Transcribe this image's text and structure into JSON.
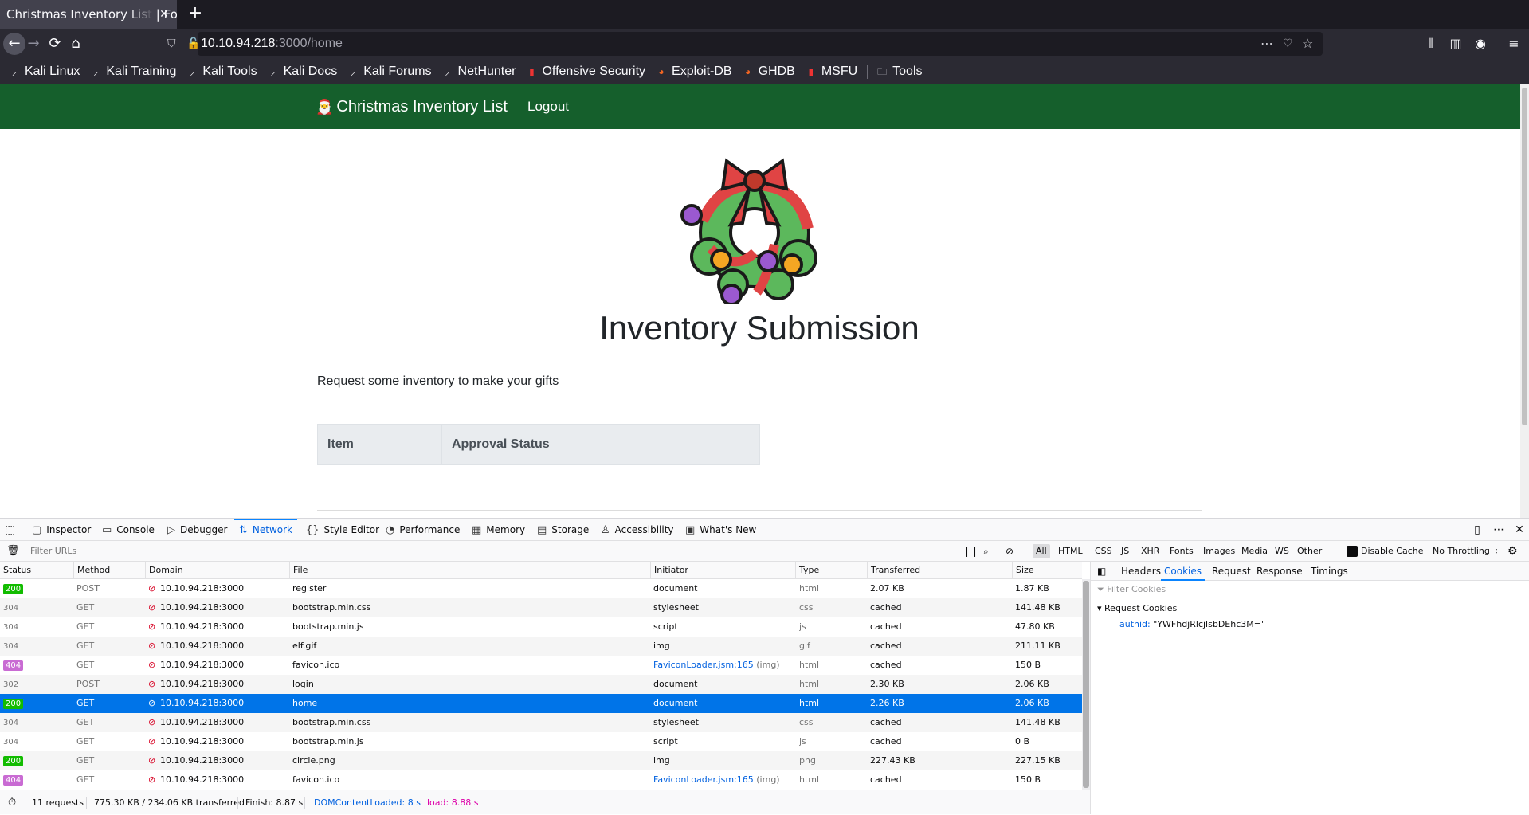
{
  "browser": {
    "tab_title": "Christmas Inventory List | Fo",
    "url_host": "10.10.94.218",
    "url_path": ":3000/home",
    "bookmarks": [
      "Kali Linux",
      "Kali Training",
      "Kali Tools",
      "Kali Docs",
      "Kali Forums",
      "NetHunter",
      "Offensive Security",
      "Exploit-DB",
      "GHDB",
      "MSFU",
      "Tools"
    ]
  },
  "site": {
    "brand": "Christmas Inventory List",
    "logout": "Logout",
    "heading": "Inventory Submission",
    "intro": "Request some inventory to make your gifts",
    "table_headers": [
      "Item",
      "Approval Status"
    ],
    "nav_color": "#155f2c"
  },
  "devtools": {
    "tabs": [
      "Inspector",
      "Console",
      "Debugger",
      "Network",
      "Style Editor",
      "Performance",
      "Memory",
      "Storage",
      "Accessibility",
      "What's New"
    ],
    "active_tab": "Network",
    "filter_placeholder": "Filter URLs",
    "type_filters": [
      "All",
      "HTML",
      "CSS",
      "JS",
      "XHR",
      "Fonts",
      "Images",
      "Media",
      "WS",
      "Other"
    ],
    "disable_cache": "Disable Cache",
    "throttling": "No Throttling ÷",
    "columns": [
      "Status",
      "Method",
      "Domain",
      "File",
      "Initiator",
      "Type",
      "Transferred",
      "Size"
    ],
    "requests": [
      {
        "status": "200",
        "method": "POST",
        "domain": "10.10.94.218:3000",
        "file": "register",
        "initiator": "document",
        "initiator_sub": "",
        "type": "html",
        "transferred": "2.07 KB",
        "size": "1.87 KB"
      },
      {
        "status": "304",
        "method": "GET",
        "domain": "10.10.94.218:3000",
        "file": "bootstrap.min.css",
        "initiator": "stylesheet",
        "initiator_sub": "",
        "type": "css",
        "transferred": "cached",
        "size": "141.48 KB"
      },
      {
        "status": "304",
        "method": "GET",
        "domain": "10.10.94.218:3000",
        "file": "bootstrap.min.js",
        "initiator": "script",
        "initiator_sub": "",
        "type": "js",
        "transferred": "cached",
        "size": "47.80 KB"
      },
      {
        "status": "304",
        "method": "GET",
        "domain": "10.10.94.218:3000",
        "file": "elf.gif",
        "initiator": "img",
        "initiator_sub": "",
        "type": "gif",
        "transferred": "cached",
        "size": "211.11 KB"
      },
      {
        "status": "404",
        "method": "GET",
        "domain": "10.10.94.218:3000",
        "file": "favicon.ico",
        "initiator": "FaviconLoader.jsm:165",
        "initiator_sub": "(img)",
        "type": "html",
        "transferred": "cached",
        "size": "150 B"
      },
      {
        "status": "302",
        "method": "POST",
        "domain": "10.10.94.218:3000",
        "file": "login",
        "initiator": "document",
        "initiator_sub": "",
        "type": "html",
        "transferred": "2.30 KB",
        "size": "2.06 KB"
      },
      {
        "status": "200",
        "method": "GET",
        "domain": "10.10.94.218:3000",
        "file": "home",
        "initiator": "document",
        "initiator_sub": "",
        "type": "html",
        "transferred": "2.26 KB",
        "size": "2.06 KB"
      },
      {
        "status": "304",
        "method": "GET",
        "domain": "10.10.94.218:3000",
        "file": "bootstrap.min.css",
        "initiator": "stylesheet",
        "initiator_sub": "",
        "type": "css",
        "transferred": "cached",
        "size": "141.48 KB"
      },
      {
        "status": "304",
        "method": "GET",
        "domain": "10.10.94.218:3000",
        "file": "bootstrap.min.js",
        "initiator": "script",
        "initiator_sub": "",
        "type": "js",
        "transferred": "cached",
        "size": "0 B"
      },
      {
        "status": "200",
        "method": "GET",
        "domain": "10.10.94.218:3000",
        "file": "circle.png",
        "initiator": "img",
        "initiator_sub": "",
        "type": "png",
        "transferred": "227.43 KB",
        "size": "227.15 KB"
      },
      {
        "status": "404",
        "method": "GET",
        "domain": "10.10.94.218:3000",
        "file": "favicon.ico",
        "initiator": "FaviconLoader.jsm:165",
        "initiator_sub": "(img)",
        "type": "html",
        "transferred": "cached",
        "size": "150 B"
      }
    ],
    "selected_row": 6,
    "side_tabs": [
      "Headers",
      "Cookies",
      "Request",
      "Response",
      "Timings"
    ],
    "active_side_tab": "Cookies",
    "cookie_filter": "Filter Cookies",
    "request_cookies_label": "Request Cookies",
    "cookie_key": "authid:",
    "cookie_value": "\"YWFhdjRlcjlsbDEhc3M=\"",
    "status_bar": {
      "requests": "11 requests",
      "transferred": "775.30 KB / 234.06 KB transferred",
      "finish": "Finish: 8.87 s",
      "dcl": "DOMContentLoaded: 8 s",
      "load": "load: 8.88 s"
    }
  }
}
